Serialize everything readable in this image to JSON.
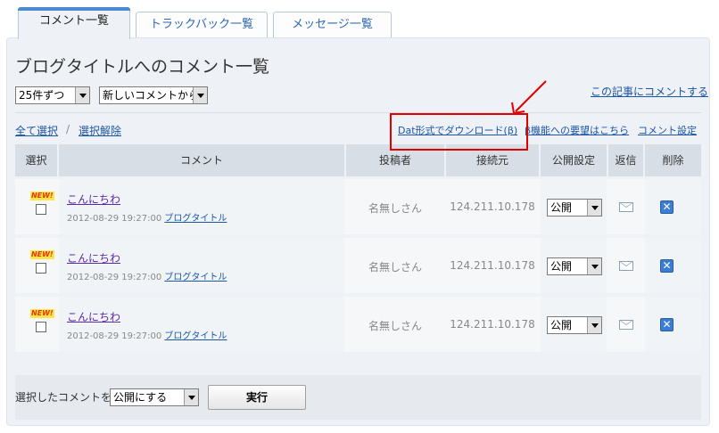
{
  "tabs": [
    {
      "label": "コメント一覧",
      "active": true
    },
    {
      "label": "トラックバック一覧",
      "active": false
    },
    {
      "label": "メッセージ一覧",
      "active": false
    }
  ],
  "page_title": "ブログタイトルへのコメント一覧",
  "per_page_select": "25件ずつ",
  "order_select": "新しいコメントから",
  "comment_on_article_link": "この記事にコメントする",
  "select_all_link": "全て選択",
  "separator": "/",
  "deselect_link": "選択解除",
  "dat_download_link": "Dat形式でダウンロード(β)",
  "feature_request_link": "β機能への要望はこちら",
  "comment_settings_link": "コメント設定",
  "table": {
    "headers": {
      "select": "選択",
      "comment": "コメント",
      "poster": "投稿者",
      "source": "接続元",
      "publish": "公開設定",
      "reply": "返信",
      "delete": "削除"
    },
    "rows": [
      {
        "badge": "NEW!",
        "title": "こんにちわ",
        "date": "2012-08-29 19:27:00",
        "blog": "ブログタイトル",
        "poster": "名無しさん",
        "ip": "124.211.10.178",
        "publish": "公開"
      },
      {
        "badge": "NEW!",
        "title": "こんにちわ",
        "date": "2012-08-29 19:27:00",
        "blog": "ブログタイトル",
        "poster": "名無しさん",
        "ip": "124.211.10.178",
        "publish": "公開"
      },
      {
        "badge": "NEW!",
        "title": "こんにちわ",
        "date": "2012-08-29 19:27:00",
        "blog": "ブログタイトル",
        "poster": "名無しさん",
        "ip": "124.211.10.178",
        "publish": "公開"
      }
    ]
  },
  "footer": {
    "label": "選択したコメントを",
    "action_select": "公開にする",
    "execute_button": "実行"
  },
  "colors": {
    "link": "#1c56a6",
    "annotation_red": "#e00000",
    "header_bg": "#d7dee6"
  },
  "icons": {
    "reply": "mail-icon",
    "delete": "close-icon"
  }
}
